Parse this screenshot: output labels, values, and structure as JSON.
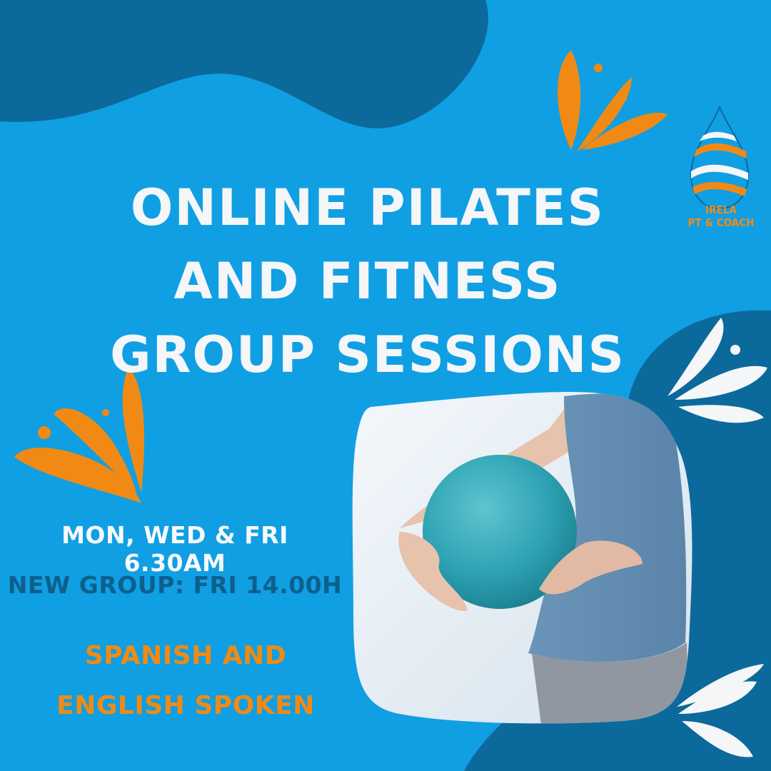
{
  "headline": {
    "line1": "ONLINE PILATES",
    "line2": "AND FITNESS",
    "line3": "GROUP SESSIONS"
  },
  "schedule": "MON, WED & FRI 6.30AM",
  "new_group": "NEW GROUP: FRI 14.00H",
  "languages": {
    "line1": "SPANISH AND",
    "line2": "ENGLISH SPOKEN"
  },
  "logo": {
    "line1": "IRELA",
    "line2": "PT & COACH"
  },
  "colors": {
    "background": "#109fe3",
    "dark_blue": "#0b6a9b",
    "orange": "#f18a14",
    "white": "#f4f6f8"
  },
  "photo": {
    "subject": "woman holding a turquoise pilates ball"
  }
}
